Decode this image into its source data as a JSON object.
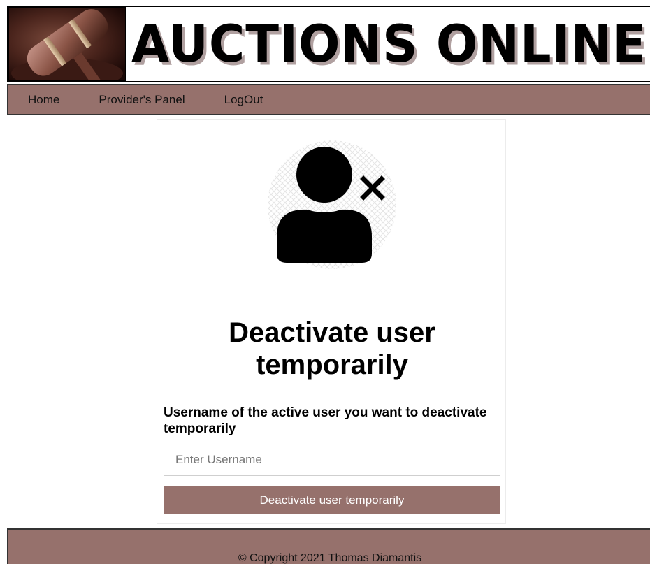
{
  "header": {
    "title": "AUCTIONS ONLINE",
    "logo_icon": "gavel-icon"
  },
  "nav": {
    "items": [
      {
        "label": "Home"
      },
      {
        "label": "Provider's Panel"
      },
      {
        "label": "LogOut"
      }
    ]
  },
  "form": {
    "avatar_icon": "user-remove-icon",
    "title": "Deactivate user temporarily",
    "field_label": "Username of the active user you want to deactivate temporarily",
    "username_value": "",
    "username_placeholder": "Enter Username",
    "submit_label": "Deactivate user temporarily"
  },
  "footer": {
    "copyright": "© Copyright 2021 Thomas Diamantis"
  },
  "colors": {
    "accent": "#96716c",
    "text": "#000000",
    "button_text": "#ffffff"
  }
}
